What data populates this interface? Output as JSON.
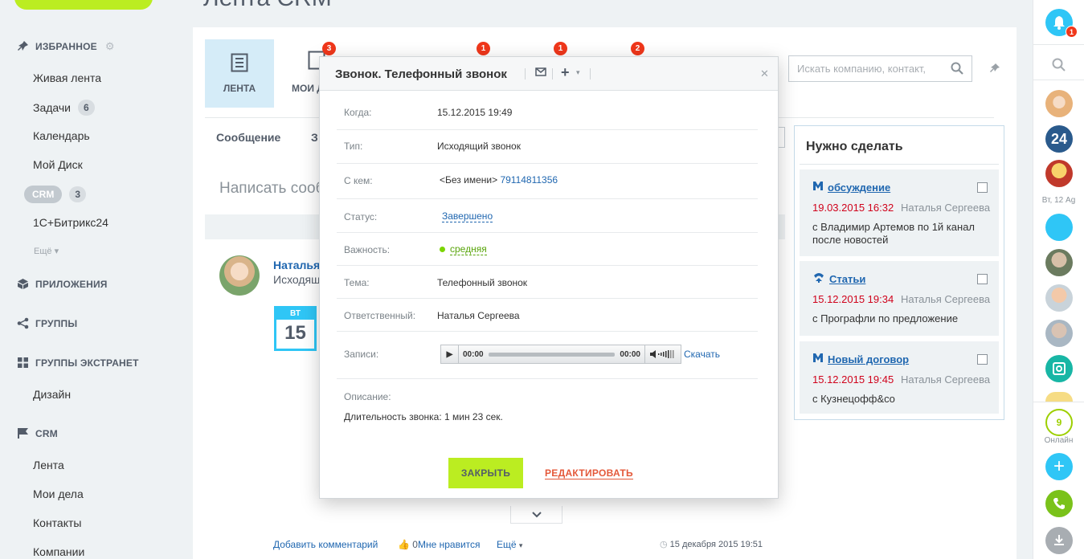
{
  "page": {
    "title_partial": "Лента CRM"
  },
  "sidebar": {
    "favorites": "ИЗБРАННОЕ",
    "items": [
      {
        "label": "Живая лента"
      },
      {
        "label": "Задачи",
        "count": "6"
      },
      {
        "label": "Календарь"
      },
      {
        "label": "Мой Диск"
      },
      {
        "label": "CRM",
        "count": "3"
      },
      {
        "label": "1С+Битрикс24"
      }
    ],
    "more": "Ещё",
    "apps": "ПРИЛОЖЕНИЯ",
    "groups": "ГРУППЫ",
    "extranet": "ГРУППЫ ЭКСТРАНЕТ",
    "extranet_items": [
      {
        "label": "Дизайн"
      }
    ],
    "crm": "CRM",
    "crm_items": [
      {
        "label": "Лента"
      },
      {
        "label": "Мои дела"
      },
      {
        "label": "Контакты"
      },
      {
        "label": "Компании"
      }
    ]
  },
  "toolbar": {
    "tabs": [
      {
        "label": "ЛЕНТА"
      },
      {
        "label": "МОИ Д",
        "badge": "3"
      }
    ],
    "badges": [
      "1",
      "1",
      "2"
    ],
    "search_placeholder": "Искать компанию, контакт,"
  },
  "feed": {
    "post_tabs": [
      "Сообщение",
      "З"
    ],
    "compose_placeholder": "Написать сооб",
    "author": "Наталья",
    "subtitle": "Исходящ",
    "calendar": {
      "dow": "ВТ",
      "day": "15"
    },
    "footer": {
      "comment": "Добавить комментарий",
      "likes": "0",
      "like": "Мне нравится",
      "more": "Ещё",
      "date": "15 декабря 2015 19:51"
    }
  },
  "todo": {
    "title": "Нужно сделать",
    "tasks": [
      {
        "title": "обсуждение",
        "date": "19.03.2015 16:32",
        "who": "Наталья Сергеева",
        "desc": "с Владимир Артемов по 1й канал после новостей",
        "icon": "meeting-icon"
      },
      {
        "title": "Статьи",
        "date": "15.12.2015 19:34",
        "who": "Наталья Сергеева",
        "desc": "с Прографли по предложение",
        "icon": "call-icon"
      },
      {
        "title": "Новый договор",
        "date": "15.12.2015 19:45",
        "who": "Наталья Сергеева",
        "desc": "с Кузнецофф&co",
        "icon": "meeting-icon"
      }
    ]
  },
  "rail": {
    "notify_count": "1",
    "b24": "24",
    "date_label": "Вт, 12 Ag",
    "online_count": "9",
    "online_label": "Онлайн"
  },
  "modal": {
    "title": "Звонок. Телефонный звонок",
    "fields": {
      "when_label": "Когда:",
      "when": "15.12.2015 19:49",
      "type_label": "Тип:",
      "type": "Исходящий звонок",
      "with_label": "С кем:",
      "with_name": "<Без имени>",
      "with_phone": "79114811356",
      "status_label": "Статус:",
      "status": "Завершено",
      "priority_label": "Важность:",
      "priority": "средняя",
      "subject_label": "Тема:",
      "subject": "Телефонный звонок",
      "responsible_label": "Ответственный:",
      "responsible": "Наталья Сергеева",
      "records_label": "Записи:",
      "time_start": "00:00",
      "time_end": "00:00",
      "download": "Скачать",
      "description_label": "Описание:",
      "description": "Длительность звонка: 1 мин 23 сек."
    },
    "close_button": "ЗАКРЫТЬ",
    "edit_button": "РЕДАКТИРОВАТЬ"
  },
  "colors": {
    "accent_green": "#bbed21",
    "link_blue": "#2067b0",
    "badge_red": "#f0371b",
    "rail_blue": "#2fc6f6"
  }
}
